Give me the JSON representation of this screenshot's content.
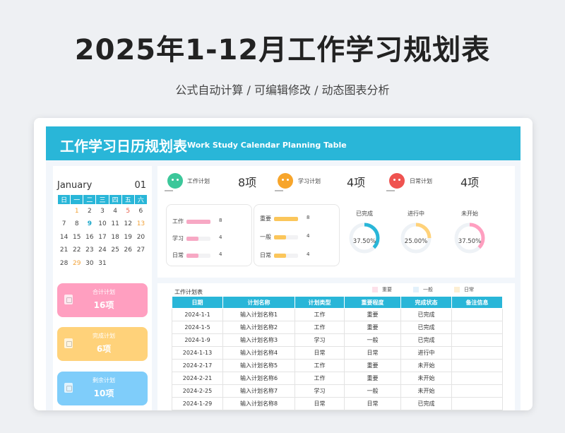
{
  "header": {
    "title": "2025年1-12月工作学习规划表",
    "subtitle": "公式自动计算 /  可编辑修改  / 动态图表分析"
  },
  "banner": {
    "title_cn": "工作学习日历规划表",
    "title_en": "Work Study Calendar Planning Table"
  },
  "calendar": {
    "month": "January",
    "month_number": "01",
    "weekdays": [
      "日",
      "一",
      "二",
      "三",
      "四",
      "五",
      "六"
    ],
    "weeks": [
      [
        "",
        "1",
        "2",
        "3",
        "4",
        "5",
        "6"
      ],
      [
        "7",
        "8",
        "9",
        "10",
        "11",
        "12",
        "13"
      ],
      [
        "14",
        "15",
        "16",
        "17",
        "18",
        "19",
        "20"
      ],
      [
        "21",
        "22",
        "23",
        "24",
        "25",
        "26",
        "27"
      ],
      [
        "28",
        "29",
        "30",
        "31",
        "",
        "",
        ""
      ]
    ]
  },
  "stats": [
    {
      "label": "合计计划",
      "value": "16项",
      "color": "#ff9fc0"
    },
    {
      "label": "完成计划",
      "value": "6项",
      "color": "#ffd27a"
    },
    {
      "label": "剩余计划",
      "value": "10项",
      "color": "#7fcdfa"
    }
  ],
  "summary": [
    {
      "label": "工作计划",
      "value": "8项",
      "icon": "green-face-icon",
      "color": "#3cc79a"
    },
    {
      "label": "学习计划",
      "value": "4项",
      "icon": "orange-face-icon",
      "color": "#f7a52b"
    },
    {
      "label": "日常计划",
      "value": "4项",
      "icon": "red-face-icon",
      "color": "#ef5350"
    }
  ],
  "chart_data": [
    {
      "type": "bar",
      "categories": [
        "工作",
        "学习",
        "日常"
      ],
      "values": [
        8,
        4,
        4
      ],
      "xlim": [
        0,
        8
      ],
      "color": "#f7a8c4"
    },
    {
      "type": "bar",
      "categories": [
        "重要",
        "一般",
        "日常"
      ],
      "values": [
        8,
        4,
        4
      ],
      "xlim": [
        0,
        8
      ],
      "color": "#fbc65b"
    },
    {
      "type": "pie",
      "donuts": [
        {
          "label": "已完成",
          "percent": 37.5,
          "value_text": "37.50%",
          "color": "#29b6d8"
        },
        {
          "label": "进行中",
          "percent": 25.0,
          "value_text": "25.00%",
          "color": "#ffd27a"
        },
        {
          "label": "未开始",
          "percent": 37.5,
          "value_text": "37.50%",
          "color": "#ff9fc0"
        }
      ]
    }
  ],
  "plan_table": {
    "title": "工作计划表",
    "legend": [
      {
        "label": "重要",
        "color": "#fde1ea"
      },
      {
        "label": "一般",
        "color": "#e3f1fb"
      },
      {
        "label": "日常",
        "color": "#fdefd3"
      }
    ],
    "columns": [
      "日期",
      "计划名称",
      "计划类型",
      "重要程度",
      "完成状态",
      "备注信息"
    ],
    "rows": [
      [
        "2024-1-1",
        "输入计划名称1",
        "工作",
        "重要",
        "已完成",
        ""
      ],
      [
        "2024-1-5",
        "输入计划名称2",
        "工作",
        "重要",
        "已完成",
        ""
      ],
      [
        "2024-1-9",
        "输入计划名称3",
        "学习",
        "一般",
        "已完成",
        ""
      ],
      [
        "2024-1-13",
        "输入计划名称4",
        "日常",
        "日常",
        "进行中",
        ""
      ],
      [
        "2024-2-17",
        "输入计划名称5",
        "工作",
        "重要",
        "未开始",
        ""
      ],
      [
        "2024-2-21",
        "输入计划名称6",
        "工作",
        "重要",
        "未开始",
        ""
      ],
      [
        "2024-2-25",
        "输入计划名称7",
        "学习",
        "一般",
        "未开始",
        ""
      ],
      [
        "2024-1-29",
        "输入计划名称8",
        "日常",
        "日常",
        "已完成",
        ""
      ]
    ]
  }
}
